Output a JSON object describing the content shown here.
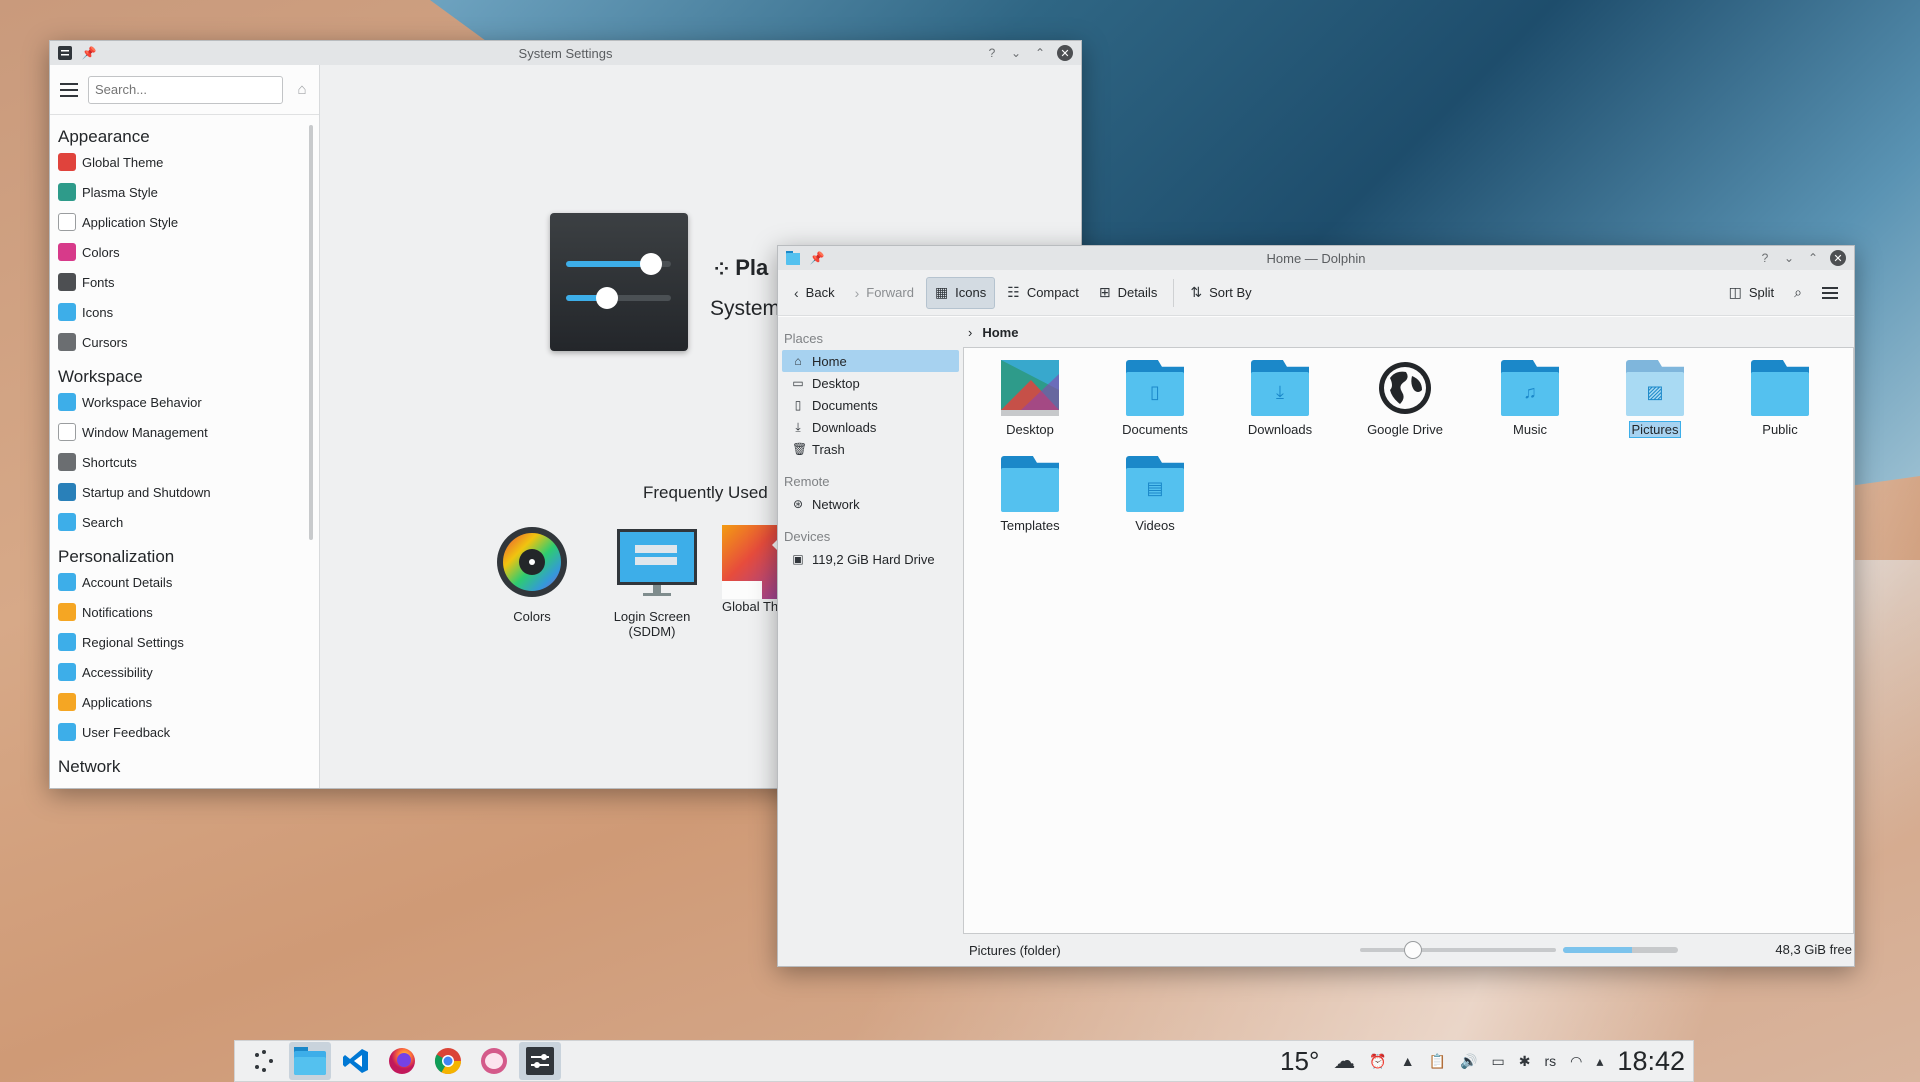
{
  "colors": {
    "accent": "#3daee9",
    "selection": "#a7d2f0",
    "folder_dark": "#1b88c9",
    "folder_light": "#54c1ef"
  },
  "system_settings": {
    "title": "System Settings",
    "search_placeholder": "Search...",
    "categories": [
      {
        "name": "Appearance",
        "items": [
          {
            "label": "Global Theme",
            "icon": "global-theme-icon",
            "color": "#e0433c"
          },
          {
            "label": "Plasma Style",
            "icon": "plasma-style-icon",
            "color": "#2e9b8a"
          },
          {
            "label": "Application Style",
            "icon": "application-style-icon",
            "color": "#ffffff"
          },
          {
            "label": "Colors",
            "icon": "colors-icon",
            "color": "#d73a8a"
          },
          {
            "label": "Fonts",
            "icon": "fonts-icon",
            "color": "#4d4f52"
          },
          {
            "label": "Icons",
            "icon": "icons-icon",
            "color": "#3daee9"
          },
          {
            "label": "Cursors",
            "icon": "cursors-icon",
            "color": "#6b6e71"
          }
        ]
      },
      {
        "name": "Workspace",
        "items": [
          {
            "label": "Workspace Behavior",
            "icon": "workspace-behavior-icon",
            "color": "#3daee9"
          },
          {
            "label": "Window Management",
            "icon": "window-management-icon",
            "color": "#ffffff"
          },
          {
            "label": "Shortcuts",
            "icon": "shortcuts-icon",
            "color": "#6b6e71"
          },
          {
            "label": "Startup and Shutdown",
            "icon": "startup-shutdown-icon",
            "color": "#2980b9"
          },
          {
            "label": "Search",
            "icon": "search-icon",
            "color": "#3daee9"
          }
        ]
      },
      {
        "name": "Personalization",
        "items": [
          {
            "label": "Account Details",
            "icon": "account-details-icon",
            "color": "#3daee9"
          },
          {
            "label": "Notifications",
            "icon": "notifications-icon",
            "color": "#f5a623"
          },
          {
            "label": "Regional Settings",
            "icon": "regional-settings-icon",
            "color": "#3daee9"
          },
          {
            "label": "Accessibility",
            "icon": "accessibility-icon",
            "color": "#3daee9"
          },
          {
            "label": "Applications",
            "icon": "applications-icon",
            "color": "#f5a623"
          },
          {
            "label": "User Feedback",
            "icon": "user-feedback-icon",
            "color": "#3daee9"
          }
        ]
      },
      {
        "name": "Network",
        "items": []
      }
    ],
    "hero_line1": "Pla",
    "hero_line2": "System",
    "frequently_used_title": "Frequently Used",
    "frequently_used": [
      {
        "label": "Colors",
        "icon": "colors-wheel-icon"
      },
      {
        "label": "Login Screen (SDDM)",
        "icon": "login-screen-icon"
      },
      {
        "label": "Global Th",
        "icon": "global-theme-icon"
      }
    ]
  },
  "dolphin": {
    "title": "Home — Dolphin",
    "toolbar": {
      "back": "Back",
      "forward": "Forward",
      "icons": "Icons",
      "compact": "Compact",
      "details": "Details",
      "sort_by": "Sort By",
      "split": "Split"
    },
    "places": {
      "places_heading": "Places",
      "places_items": [
        {
          "label": "Home",
          "icon": "home-icon",
          "glyph": "⌂",
          "selected": true
        },
        {
          "label": "Desktop",
          "icon": "desktop-icon",
          "glyph": "▭",
          "selected": false
        },
        {
          "label": "Documents",
          "icon": "documents-icon",
          "glyph": "▯",
          "selected": false
        },
        {
          "label": "Downloads",
          "icon": "downloads-icon",
          "glyph": "⤓",
          "selected": false
        },
        {
          "label": "Trash",
          "icon": "trash-icon",
          "glyph": "🗑",
          "selected": false
        }
      ],
      "remote_heading": "Remote",
      "remote_items": [
        {
          "label": "Network",
          "icon": "network-icon",
          "glyph": "⊛"
        }
      ],
      "devices_heading": "Devices",
      "devices_items": [
        {
          "label": "119,2 GiB Hard Drive",
          "icon": "hard-drive-icon",
          "glyph": "▣"
        }
      ]
    },
    "breadcrumb": "Home",
    "files": [
      {
        "label": "Desktop",
        "type": "desktop",
        "glyph": ""
      },
      {
        "label": "Documents",
        "type": "folder",
        "glyph": "▯"
      },
      {
        "label": "Downloads",
        "type": "folder",
        "glyph": "⤓"
      },
      {
        "label": "Google Drive",
        "type": "globe",
        "glyph": ""
      },
      {
        "label": "Music",
        "type": "folder",
        "glyph": "♫"
      },
      {
        "label": "Pictures",
        "type": "folder",
        "glyph": "▨",
        "selected": true
      },
      {
        "label": "Public",
        "type": "folder",
        "glyph": ""
      },
      {
        "label": "Templates",
        "type": "folder",
        "glyph": ""
      },
      {
        "label": "Videos",
        "type": "folder",
        "glyph": "▤"
      }
    ],
    "status_text": "Pictures (folder)",
    "zoom_fraction": 0.27,
    "used_fraction": 0.6,
    "free_space": "48,3 GiB free"
  },
  "taskbar": {
    "apps": [
      {
        "name": "application-launcher-icon",
        "active": false
      },
      {
        "name": "dolphin-icon",
        "active": true
      },
      {
        "name": "vscode-icon",
        "active": false
      },
      {
        "name": "firefox-icon",
        "active": false
      },
      {
        "name": "chrome-icon",
        "active": false
      },
      {
        "name": "opera-icon",
        "active": false
      },
      {
        "name": "system-settings-icon",
        "active": true
      }
    ],
    "temperature": "15°",
    "keyboard_layout": "rs",
    "clock": "18:42"
  }
}
